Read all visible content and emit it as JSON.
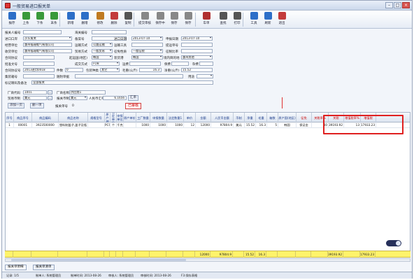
{
  "window": {
    "title": "一般贸易进口报关单"
  },
  "toolbar": {
    "buttons": [
      {
        "label": "报存",
        "color": "#2d6fc8"
      },
      {
        "label": "上条",
        "color": "#3a9a3a"
      },
      {
        "label": "下条",
        "color": "#3a9a3a"
      },
      {
        "label": "末条",
        "color": "#3a9a3a"
      },
      {
        "label": "新增",
        "color": "#2d6fc8"
      },
      {
        "label": "删增",
        "color": "#2d6fc8"
      },
      {
        "label": "修改",
        "color": "#c07a20"
      },
      {
        "label": "删除",
        "color": "#c33b3b"
      },
      {
        "label": "复制",
        "color": "#555555"
      },
      {
        "label": "提交审核",
        "color": "#888888"
      },
      {
        "label": "保存中",
        "color": "#888888"
      },
      {
        "label": "保存",
        "color": "#888888"
      },
      {
        "label": "保存",
        "color": "#888888"
      },
      {
        "label": "车单",
        "color": "#b03030"
      },
      {
        "label": "查找",
        "color": "#555555"
      },
      {
        "label": "打印",
        "color": "#555555"
      },
      {
        "label": "工具",
        "color": "#2d6fc8"
      },
      {
        "label": "刷新",
        "color": "#2d6fc8"
      },
      {
        "label": "退出",
        "color": "#c33b3b"
      }
    ]
  },
  "form": {
    "row1": {
      "l1": "报关人编号",
      "l2": "海关编号"
    },
    "row2": {
      "l1": "进口口岸",
      "v1": "沙头角关",
      "l2": "备案号",
      "l3": "进口日期",
      "v3": "2013-07-10",
      "l4": "申报日期",
      "v4": "2013-07-10"
    },
    "row3": {
      "l1": "经营单位",
      "v1": "惠州福瑞电气有限公司",
      "l2": "运输方式",
      "v2": "公路运输",
      "l3": "运输工具",
      "l4": "提运单号"
    },
    "row4": {
      "l1": "收货单位",
      "v1": "惠州福瑞电气有限公司",
      "l2": "贸易方式",
      "v2": "一般贸易",
      "l3": "征免性质",
      "v3": "一般征税",
      "l4": "征税比率"
    },
    "row5": {
      "l1": "合同协议",
      "l2": "起运国(地区)",
      "v2": "韩国",
      "l3": "装货港",
      "v3": "韩国",
      "l4": "境内目的地",
      "v4": "惠州其他"
    },
    "row6": {
      "l1": "批准文号",
      "l2": "成交方式",
      "v2": "FOB",
      "l3": "运费",
      "l4": "保费",
      "l5": "杂费"
    },
    "row7": {
      "l1": "合同协议号",
      "v1": "2013进口0018",
      "l2": "件数",
      "v2": "0",
      "l3": "包装种类",
      "v3": "其它",
      "l4": "毛重(公斤)",
      "v4": "16.3",
      "l5": "净重(公斤)",
      "v5": "15.52"
    },
    "row8": {
      "l1": "集装箱号",
      "l2": "随附单据",
      "l3": "用途"
    },
    "row9": {
      "l1": "标记唛码及备注",
      "v1": "全部报关"
    },
    "row10": {
      "l1": "厂商代码",
      "v1": "1001",
      "l2": "厂商名称",
      "v2": "供应商1"
    },
    "row11": {
      "l1": "贸易币制",
      "v1": "美元",
      "l2": "报关币制",
      "v2": "美元",
      "l3": "人民币汇率",
      "v3": "6.1656",
      "btn": "汇率"
    },
    "row12": {
      "b1": "添加一页",
      "b2": "删一项",
      "l1": "报关单号",
      "v1": "0",
      "b3": "已审核"
    }
  },
  "grid": {
    "headers": [
      {
        "label": "序号",
        "red": false
      },
      {
        "label": "商品序号",
        "red": false
      },
      {
        "label": "商品编码",
        "red": false
      },
      {
        "label": "商品名称",
        "red": false
      },
      {
        "label": "规格型号",
        "red": false
      },
      {
        "label": "原产地",
        "red": false
      },
      {
        "label": "法定单位",
        "red": false
      },
      {
        "label": "申报单位",
        "red": false
      },
      {
        "label": "原产单价",
        "red": false
      },
      {
        "label": "工厂数量",
        "red": false
      },
      {
        "label": "申报数量",
        "red": false
      },
      {
        "label": "法定数量1",
        "red": false
      },
      {
        "label": "单价",
        "red": false
      },
      {
        "label": "金额",
        "red": false
      },
      {
        "label": "人民币金额",
        "red": false
      },
      {
        "label": "币制",
        "red": false
      },
      {
        "label": "净重",
        "red": false
      },
      {
        "label": "毛重",
        "red": false
      },
      {
        "label": "箱数",
        "red": false
      },
      {
        "label": "原产国(地区)",
        "red": false
      },
      {
        "label": "征免",
        "red": true
      },
      {
        "label": "关税率%",
        "red": true
      },
      {
        "label": "关税",
        "red": true
      },
      {
        "label": "增值税率%",
        "red": true
      },
      {
        "label": "增值税",
        "red": true
      }
    ],
    "rows": [
      [
        "1",
        "00001",
        "3923500000",
        "塑料制盖子,盖子及瓶",
        "",
        "PCS",
        "个",
        "千克",
        "",
        "1000",
        "1000",
        "1000",
        "12",
        "12000",
        "97804.9",
        "美元",
        "15.52",
        "16.3",
        "5",
        "韩国",
        "保证金",
        "40",
        "39193.92",
        "13",
        "17933.23"
      ]
    ]
  },
  "totals": {
    "amount": "12000",
    "rmb": "97804.9",
    "net": "15.52",
    "gross": "16.3",
    "duty": "39193.92",
    "vat": "17933.23"
  },
  "tabs": [
    "报关单明细",
    "报关单清单"
  ],
  "status": {
    "s1": "记录: 1/5",
    "s2": "制单人: 系统管理员",
    "s3": "制单时间: 2013-08-26",
    "s4": "审核人: 系统管理员",
    "s5": "审核时间: 2013-08-26",
    "s6": "F3:保存表格"
  }
}
